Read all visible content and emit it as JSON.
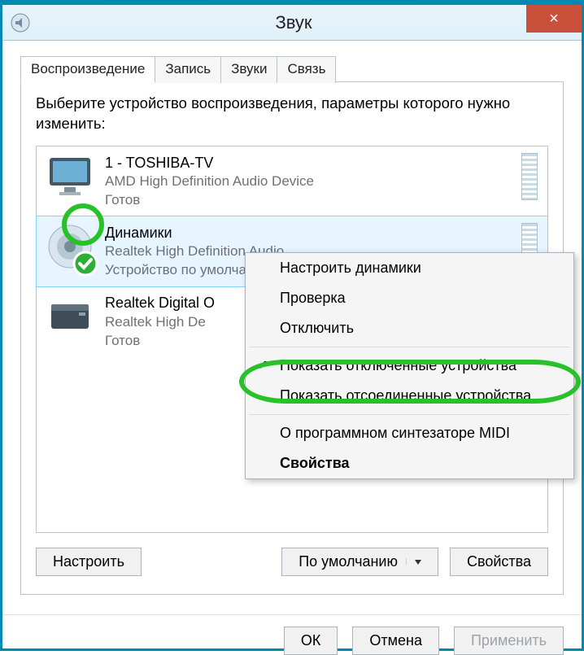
{
  "window": {
    "title": "Звук"
  },
  "tabs": [
    "Воспроизведение",
    "Запись",
    "Звуки",
    "Связь"
  ],
  "active_tab_index": 0,
  "instruction": "Выберите устройство воспроизведения, параметры которого нужно изменить:",
  "devices": [
    {
      "title": "1 - TOSHIBA-TV",
      "driver": "AMD High Definition Audio Device",
      "status": "Готов",
      "icon": "monitor",
      "default": false,
      "selected": false
    },
    {
      "title": "Динамики",
      "driver": "Realtek High Definition Audio",
      "status": "Устройство по умолчанию",
      "icon": "speaker",
      "default": true,
      "selected": true
    },
    {
      "title": "Realtek Digital O",
      "driver": "Realtek High De",
      "status": "Готов",
      "icon": "audio-box",
      "default": false,
      "selected": false
    }
  ],
  "context_menu": {
    "items": [
      {
        "label": "Настроить динамики",
        "checked": false,
        "bold": false
      },
      {
        "label": "Проверка",
        "checked": false,
        "bold": false
      },
      {
        "label": "Отключить",
        "checked": false,
        "bold": false
      },
      {
        "sep": true
      },
      {
        "label": "Показать отключенные устройства",
        "checked": true,
        "bold": false
      },
      {
        "label": "Показать отсоединенные устройства",
        "checked": false,
        "bold": false
      },
      {
        "sep": true
      },
      {
        "label": "О программном синтезаторе MIDI",
        "checked": false,
        "bold": false
      },
      {
        "label": "Свойства",
        "checked": false,
        "bold": true
      }
    ]
  },
  "buttons": {
    "configure": "Настроить",
    "default_drop": "По умолчанию",
    "properties": "Свойства",
    "ok": "ОК",
    "cancel": "Отмена",
    "apply": "Применить"
  },
  "colors": {
    "accent_green": "#28c12a",
    "close_red": "#c9503b",
    "border_blue": "#008ab3",
    "selection": "#e6f5ff"
  },
  "icons": {
    "close": "×",
    "app": "sound-control",
    "check": "✔"
  }
}
